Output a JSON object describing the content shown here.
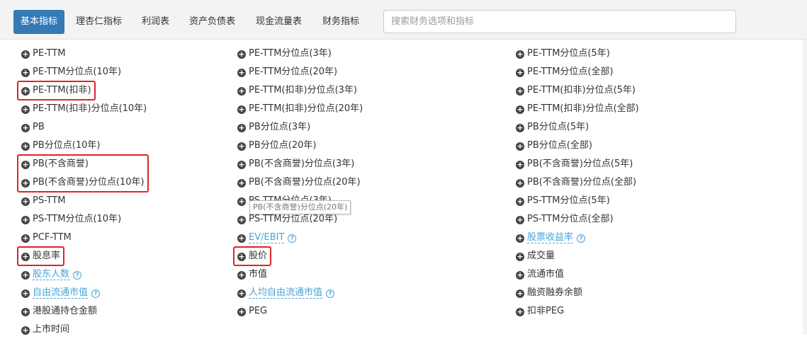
{
  "tabs": [
    "基本指标",
    "理杏仁指标",
    "利润表",
    "资产负债表",
    "现金流量表",
    "财务指标"
  ],
  "search": {
    "placeholder": "搜索财务选项和指标"
  },
  "columns": [
    [
      {
        "label": "PE-TTM"
      },
      {
        "label": "PE-TTM分位点(10年)"
      },
      {
        "label": "PE-TTM(扣非)",
        "highlighted": true
      },
      {
        "label": "PE-TTM(扣非)分位点(10年)"
      },
      {
        "label": "PB"
      },
      {
        "label": "PB分位点(10年)"
      },
      {
        "label": "PB(不含商誉)",
        "highlighted": true
      },
      {
        "label": "PB(不含商誉)分位点(10年)",
        "highlighted": true
      },
      {
        "label": "PS-TTM"
      },
      {
        "label": "PS-TTM分位点(10年)"
      },
      {
        "label": "PCF-TTM"
      },
      {
        "label": "股息率",
        "highlighted": true
      },
      {
        "label": "股东人数",
        "link": true
      },
      {
        "label": "自由流通市值",
        "link": true
      },
      {
        "label": "港股通持仓金额"
      },
      {
        "label": "上市时间"
      }
    ],
    [
      {
        "label": "PE-TTM分位点(3年)"
      },
      {
        "label": "PE-TTM分位点(20年)"
      },
      {
        "label": "PE-TTM(扣非)分位点(3年)"
      },
      {
        "label": "PE-TTM(扣非)分位点(20年)"
      },
      {
        "label": "PB分位点(3年)"
      },
      {
        "label": "PB分位点(20年)"
      },
      {
        "label": "PB(不含商誉)分位点(3年)"
      },
      {
        "label": "PB(不含商誉)分位点(20年)"
      },
      {
        "label": "PS-TTM分位点(3年)"
      },
      {
        "label": "PS-TTM分位点(20年)"
      },
      {
        "label": "EV/EBIT",
        "link": true
      },
      {
        "label": "股价",
        "highlighted": true
      },
      {
        "label": "市值"
      },
      {
        "label": "人均自由流通市值",
        "link": true
      },
      {
        "label": "PEG"
      }
    ],
    [
      {
        "label": "PE-TTM分位点(5年)"
      },
      {
        "label": "PE-TTM分位点(全部)"
      },
      {
        "label": "PE-TTM(扣非)分位点(5年)"
      },
      {
        "label": "PE-TTM(扣非)分位点(全部)"
      },
      {
        "label": "PB分位点(5年)"
      },
      {
        "label": "PB分位点(全部)"
      },
      {
        "label": "PB(不含商誉)分位点(5年)"
      },
      {
        "label": "PB(不含商誉)分位点(全部)"
      },
      {
        "label": "PS-TTM分位点(5年)"
      },
      {
        "label": "PS-TTM分位点(全部)"
      },
      {
        "label": "股票收益率",
        "link": true
      },
      {
        "label": "成交量"
      },
      {
        "label": "流通市值"
      },
      {
        "label": "融资融券余额"
      },
      {
        "label": "扣非PEG"
      }
    ]
  ],
  "tooltip": "PB(不含商誉)分位点(20年)",
  "icons": {
    "add": "plus-circle-icon",
    "help": "question-circle-icon"
  },
  "colors": {
    "tab_active": "#337ab7",
    "link": "#4aa3d6",
    "highlight": "#e0242a"
  }
}
